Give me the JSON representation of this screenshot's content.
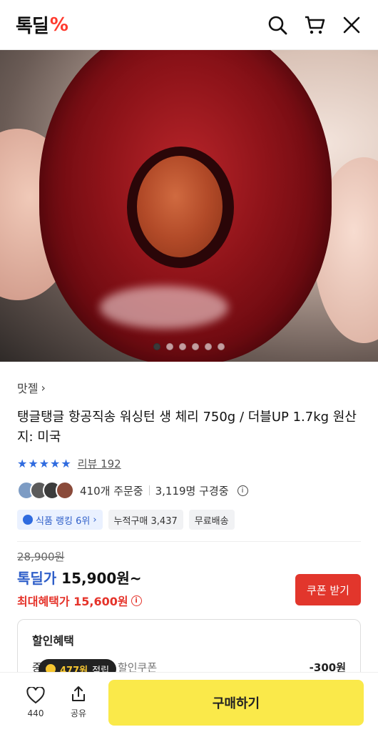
{
  "header": {
    "logo_text": "톡딜",
    "logo_mark": "%",
    "icons": [
      "search-icon",
      "cart-icon",
      "close-icon"
    ]
  },
  "hero": {
    "image_count": 6,
    "active_index": 0
  },
  "product": {
    "brand": "맛젤",
    "brand_chevron": "›",
    "title": "탱글탱글 항공직송 워싱턴 생 체리 750g / 더블UP 1.7kg 원산지: 미국",
    "stars": "★★★★★",
    "review_label": "리뷰 192",
    "order_count": "410개 주문중",
    "watch_count": "3,119명 구경중",
    "info_glyph": "i",
    "tags": {
      "rank": "식품 랭킹 6위",
      "rank_chevron": "›",
      "sales": "누적구매 3,437",
      "shipping": "무료배송"
    }
  },
  "price": {
    "original": "28,900원",
    "deal_label": "톡딜가",
    "deal_value": "15,900원~",
    "max_label": "최대혜택가 15,600원",
    "coupon_button": "쿠폰 받기"
  },
  "benefit": {
    "heading": "할인혜택",
    "row_label": "중복할인",
    "row_sub": "장바구니 할인쿠폰",
    "row_value": "-300원"
  },
  "bottom": {
    "like_count": "440",
    "share_label": "공유",
    "buy_label": "구매하기",
    "points_value": "477원",
    "points_suffix": "적립"
  },
  "colors": {
    "accent_blue": "#2f5fc9",
    "accent_red": "#e2362c",
    "buy_yellow": "#fae94a"
  }
}
